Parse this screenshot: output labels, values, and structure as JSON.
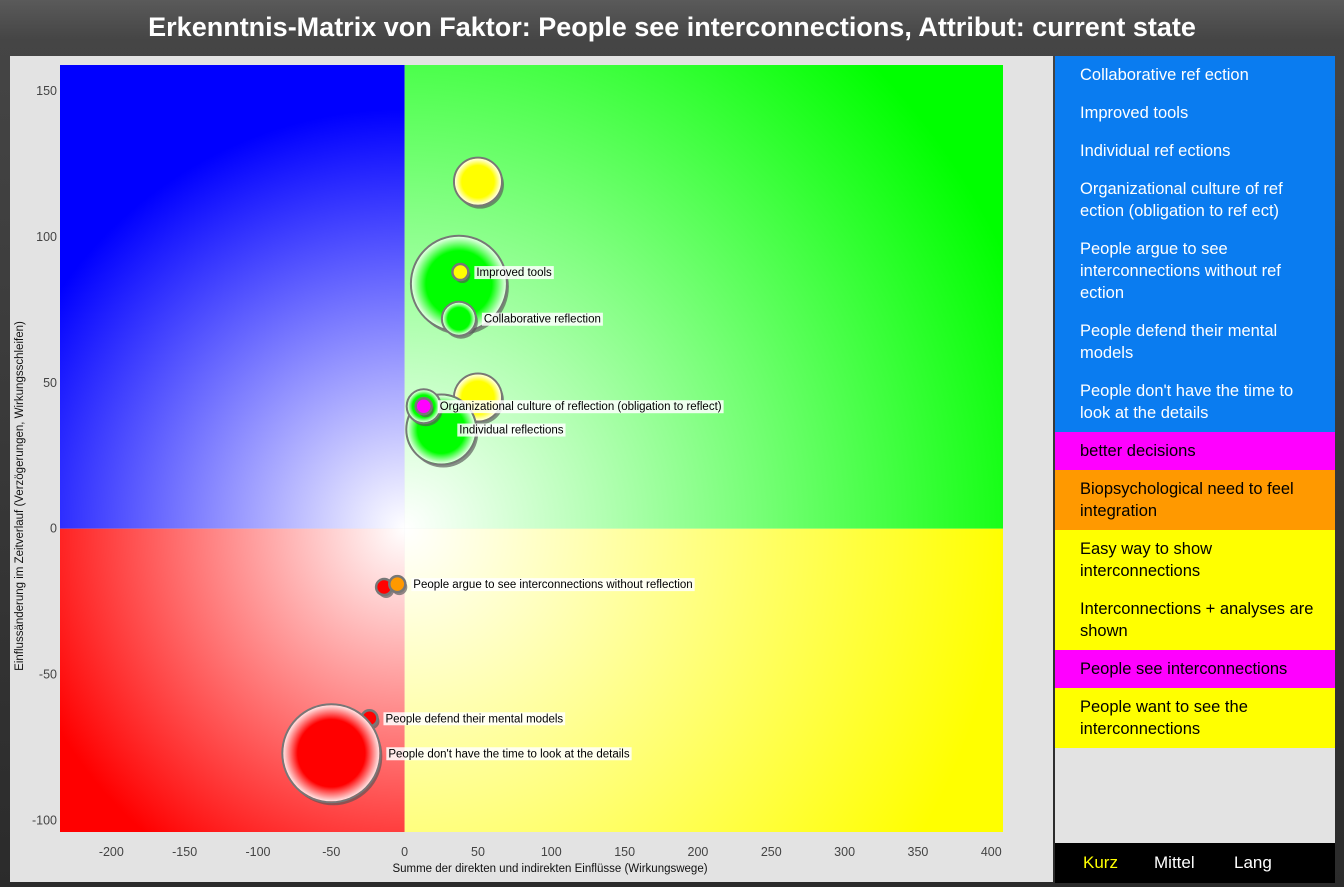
{
  "title": "Erkenntnis-Matrix von Faktor: People see interconnections, Attribut: current state",
  "chart_data": {
    "type": "scatter",
    "xlabel": "Summe der direkten und indirekten Einflüsse (Wirkungswege)",
    "ylabel": "Einflussänderung im Zeitverlauf (Verzögerungen, Wirkungsschleifen)",
    "xlim": [
      -235,
      408
    ],
    "ylim": [
      -104,
      159
    ],
    "x_ticks": [
      -200,
      -150,
      -100,
      -50,
      0,
      50,
      100,
      150,
      200,
      250,
      300,
      350,
      400
    ],
    "y_ticks": [
      150,
      100,
      50,
      0,
      -50,
      -100
    ],
    "quadrant_colors": {
      "top_left": "#0000ff",
      "top_right": "#00ff00",
      "bottom_left": "#ff0000",
      "bottom_right": "#ffff00"
    },
    "points": [
      {
        "label": "",
        "x": 50,
        "y": 119,
        "size": "medium",
        "color": "#ffff00"
      },
      {
        "label": "",
        "x": 37,
        "y": 84,
        "size": "xlarge",
        "color": "#00ff00"
      },
      {
        "label": "Improved tools",
        "x": 38,
        "y": 88,
        "size": "tiny",
        "color": "#ffff00"
      },
      {
        "label": "Collaborative reflection",
        "x": 37,
        "y": 72,
        "size": "small",
        "color": "#00ff00"
      },
      {
        "label": "",
        "x": 50,
        "y": 45,
        "size": "medium",
        "color": "#ffff00"
      },
      {
        "label": "",
        "x": 25,
        "y": 34,
        "size": "large",
        "color": "#00ff00"
      },
      {
        "label": "",
        "x": 13,
        "y": 42,
        "size": "small",
        "color": "#00ff00"
      },
      {
        "label": "Organizational culture of reflection (obligation to reflect)",
        "x": 13,
        "y": 42,
        "size": "tiny",
        "color": "#ff00ff"
      },
      {
        "label": "Individual reflections",
        "x": 25,
        "y": 34,
        "size": "none",
        "color": "#00ff00"
      },
      {
        "label": "",
        "x": -14,
        "y": -20,
        "size": "tiny",
        "color": "#ff0000"
      },
      {
        "label": "People argue to see interconnections without reflection",
        "x": -5,
        "y": -19,
        "size": "tiny",
        "color": "#ff9900"
      },
      {
        "label": "People defend their mental models",
        "x": -24,
        "y": -65,
        "size": "tiny",
        "color": "#ff0000"
      },
      {
        "label": "People don't have the time to look at the details",
        "x": -50,
        "y": -77,
        "size": "xxlarge",
        "color": "#ff0000"
      }
    ]
  },
  "legend": {
    "items": [
      {
        "label": "Collaborative ref ection",
        "bg": "#0a7cf0",
        "fg": "#ffffff"
      },
      {
        "label": "Improved tools",
        "bg": "#0a7cf0",
        "fg": "#ffffff"
      },
      {
        "label": "Individual ref ections",
        "bg": "#0a7cf0",
        "fg": "#ffffff"
      },
      {
        "label": "Organizational culture of ref ection (obligation to ref ect)",
        "bg": "#0a7cf0",
        "fg": "#ffffff"
      },
      {
        "label": "People argue to see interconnections without ref ection",
        "bg": "#0a7cf0",
        "fg": "#ffffff"
      },
      {
        "label": "People defend their mental models",
        "bg": "#0a7cf0",
        "fg": "#ffffff"
      },
      {
        "label": "People don't have the time to look at the details",
        "bg": "#0a7cf0",
        "fg": "#ffffff"
      },
      {
        "label": "better decisions",
        "bg": "#ff00ff",
        "fg": "#000000"
      },
      {
        "label": "Biopsychological need to feel integration",
        "bg": "#ff9900",
        "fg": "#000000"
      },
      {
        "label": "Easy way to show interconnections",
        "bg": "#ffff00",
        "fg": "#000000"
      },
      {
        "label": "Interconnections + analyses are shown",
        "bg": "#ffff00",
        "fg": "#000000"
      },
      {
        "label": "People see interconnections",
        "bg": "#ff00ff",
        "fg": "#000000"
      },
      {
        "label": "People want to see the interconnections",
        "bg": "#ffff00",
        "fg": "#000000"
      }
    ]
  },
  "tabs": {
    "kurz": "Kurz",
    "mittel": "Mittel",
    "lang": "Lang",
    "active": "kurz",
    "active_color": "#ffff00"
  }
}
